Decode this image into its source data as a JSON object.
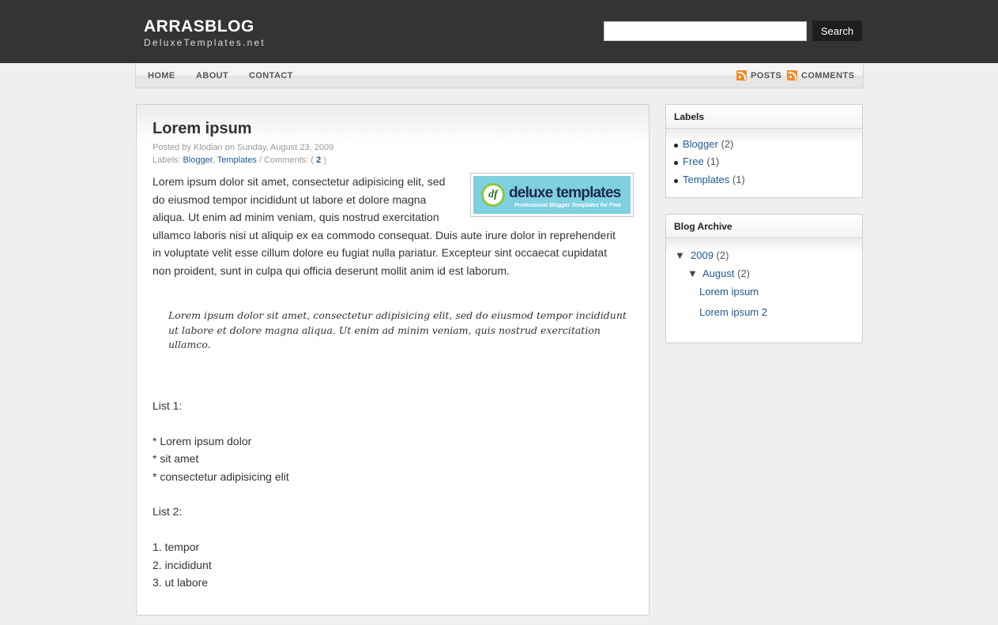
{
  "header": {
    "title": "ARRASBLOG",
    "subtitle": "DeluxeTemplates.net",
    "search_placeholder": "",
    "search_button": "Search"
  },
  "nav": {
    "items": [
      "HOME",
      "ABOUT",
      "CONTACT"
    ],
    "feeds": [
      "POSTS",
      "COMMENTS"
    ]
  },
  "post": {
    "title": "Lorem ipsum",
    "posted_by_prefix": "Posted by",
    "author": "Klodian",
    "date_prefix": "on",
    "date": "Sunday, August 23, 2009",
    "labels_prefix": "Labels:",
    "labels": [
      "Blogger",
      "Templates"
    ],
    "comments_prefix": "/ Comments: (",
    "comments_count": "2",
    "comments_suffix": ")",
    "thumbnail": {
      "brand_name": "deluxe templates",
      "brand_tagline": "Professional Blogger Templates for Free"
    },
    "paragraph_lines": [
      "Lorem ipsum dolor sit amet, consectetur adipisicing elit, sed",
      "do eiusmod tempor incididunt ut labore et dolore magna",
      "aliqua. Ut enim ad minim veniam, quis nostrud exercitation",
      "ullamco laboris nisi ut aliquip ex ea commodo consequat. Duis aute irure dolor in reprehenderit",
      "in voluptate velit esse cillum dolore eu fugiat nulla pariatur. Excepteur sint occaecat cupidatat",
      "non proident, sunt in culpa qui officia deserunt mollit anim id est laborum."
    ],
    "quote_lines": [
      "Lorem ipsum dolor sit amet, consectetur adipisicing elit, sed do eiusmod tempor incididunt",
      "ut labore et dolore magna aliqua. Ut enim ad minim veniam, quis nostrud exercitation",
      "ullamco."
    ],
    "list1_title": "List 1:",
    "list1_items": [
      "* Lorem ipsum dolor",
      "* sit amet",
      "* consectetur adipisicing elit"
    ],
    "list2_title": "List 2:",
    "list2_items": [
      "1. tempor",
      "2. incididunt",
      "3. ut labore"
    ]
  },
  "sidebar": {
    "labels_widget": {
      "title": "Labels",
      "items": [
        {
          "name": "Blogger",
          "count": "(2)"
        },
        {
          "name": "Free",
          "count": "(1)"
        },
        {
          "name": "Templates",
          "count": "(1)"
        }
      ]
    },
    "archive_widget": {
      "title": "Blog Archive",
      "year": {
        "arrow": "▼",
        "name": "2009",
        "count": "(2)"
      },
      "month": {
        "arrow": "▼",
        "name": "August",
        "count": "(2)"
      },
      "posts": [
        "Lorem ipsum",
        "Lorem ipsum 2"
      ]
    }
  },
  "colors": {
    "header_bg": "#343434",
    "link": "#215a96",
    "rss": "#f08a24",
    "page_bg": "#efefef"
  }
}
